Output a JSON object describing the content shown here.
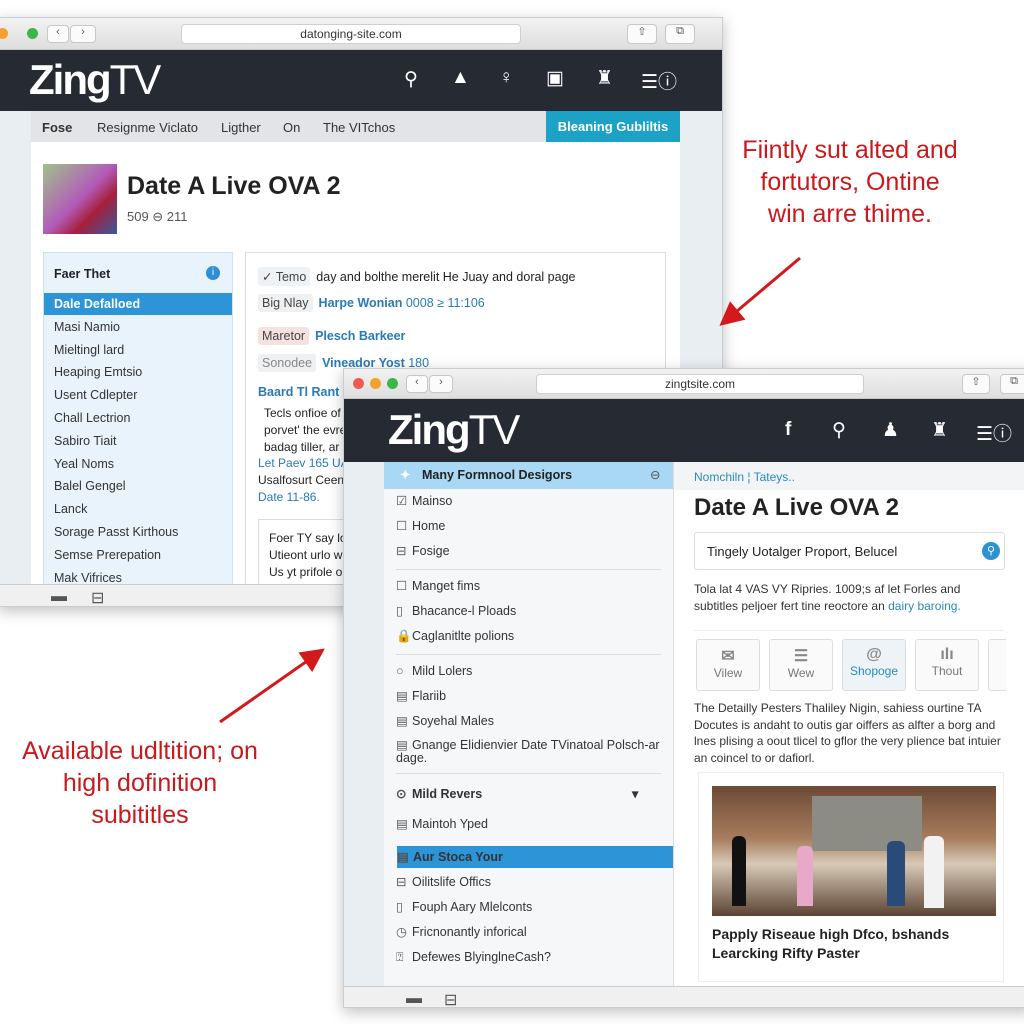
{
  "window1": {
    "url": "datongіng-site.com",
    "logo_main": "Zing",
    "logo_tv": "TV",
    "header_icons": [
      "search-icon",
      "navigate-icon",
      "user-icon",
      "screen-icon",
      "bottle-icon",
      "menu-info-icon"
    ],
    "nav": [
      "Fose",
      "Resignme Viclato",
      "Ligther",
      "On",
      "The VITchos"
    ],
    "nav_button": "Bleaning Gubliltis",
    "title": "Date A Live OVA 2",
    "subtitle": "509 ⊖ 211",
    "sidebar": {
      "heading": "Faer Thet",
      "items": [
        "Dale Defalloed",
        "Masi Namio",
        "Mieltingl lard",
        "Heaping Emtsio",
        "Usent Cdlepter",
        "Chall Lectrion",
        "Sabiro Tiait",
        "Yeal Noms",
        "Balel Gengel",
        "Lanck",
        "Sorage Passt Kirthous",
        "Semse Prerepation",
        "Mak Vifrices"
      ]
    },
    "details": [
      {
        "tag": "✓ Temo",
        "value": "day and bolthe merelit He Juay and doral page"
      },
      {
        "tag": "Big Nlay",
        "value": "Harpe Wonian",
        "extra": "0008 ≥ 11:106"
      },
      {
        "tag": "Maretor",
        "value": "Plesch Barkeer"
      },
      {
        "tag": "Sonodee",
        "value": "Vineador Yost",
        "extra": "180"
      }
    ],
    "section_title": "Baard Tl Rant",
    "section_lines": [
      "Tecls onfioe of",
      "porvet' the evre",
      "badag tiller, ar"
    ],
    "link1": "Let Paev 165 UA",
    "line2": "Usalfosurt Ceen",
    "link2": "Date 11-86.",
    "box_lines": [
      "Foer TY say lo",
      "Utieont urlo wi",
      "Us yt prifole o"
    ]
  },
  "window2": {
    "url": "zingtsite.com",
    "logo_main": "Zing",
    "logo_tv": "TV",
    "sidebar": {
      "header": "Many Formnool Desigors",
      "group1": [
        "Mainso",
        "Home",
        "Fosige"
      ],
      "group2": [
        "Manget fims",
        "Bhacance-l Ploads",
        "Caglanitlte polions"
      ],
      "group3": [
        "Mild Lolers",
        "Flariib",
        "Soyehal Males",
        "Gnange Elidienvier Date TVinatoal Polsch-ar dage."
      ],
      "section": "Mild Revers",
      "group4": [
        "Maintoh Yped"
      ],
      "selected": "Aur Stoca Your",
      "group5": [
        "Oilitslife Offics",
        "Fouph Aary Mlelconts",
        "Fricnonantly inforical",
        "Defewes BlyinglneCash?"
      ]
    },
    "breadcrumb": [
      "Nomchiln",
      "Tateys.."
    ],
    "title": "Date A Live OVA 2",
    "search_value": "Tingely Uotalger Proport, Belucel",
    "desc": "Tola lat 4 VAS VY Ripries. 1009;s af let Forles and subtitles peljoer fert tine reoctore an ",
    "desc_link": "dairy baroing.",
    "cards": [
      {
        "icon": "✉",
        "label": "Vilew"
      },
      {
        "icon": "☰",
        "label": "Wew"
      },
      {
        "icon": "@",
        "label": "Shopoge"
      },
      {
        "icon": "ılı",
        "label": "Thout"
      }
    ],
    "body": "The Detailly Pesters Thaliley Nigin, sahiess ourtine TA Docutes is andaht to outis gar oiffers as alfter a borg and lnes plising a oout tlicel to gflor the very plience bat intuier an coincel to or dafiorl.",
    "caption": "Papply Riseaue high Dfco, bshands Learcking Rifty Paster"
  },
  "annotations": {
    "top_right": "Fiintly sut alted and fortutors, Ontine win arre thime.",
    "bottom_left": "Available udltition; on high dofinition subititles",
    "color": "#c8191c"
  }
}
